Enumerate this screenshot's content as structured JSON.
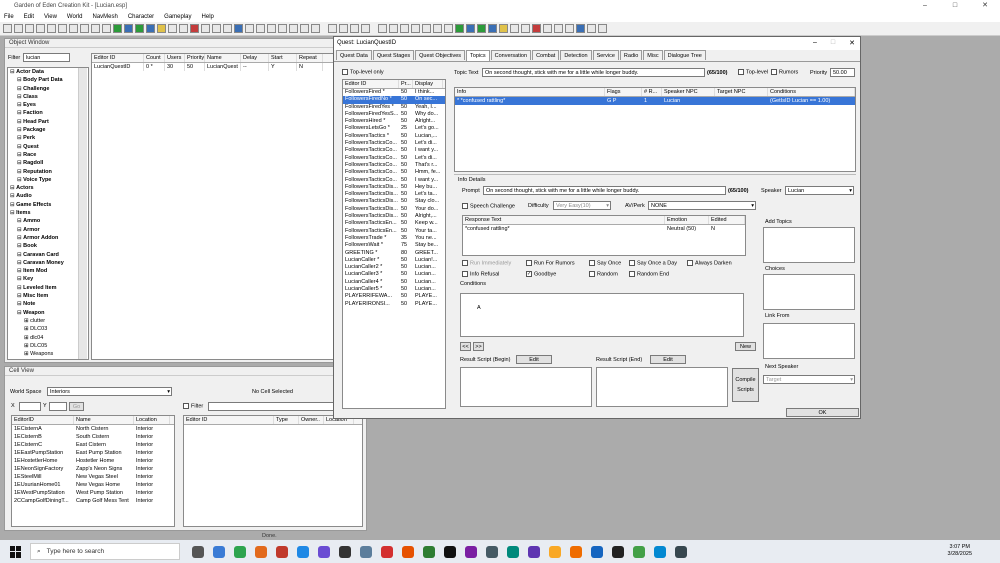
{
  "app": {
    "title": "Garden of Eden Creation Kit - [Lucian.esp]",
    "status": "Done."
  },
  "menu": [
    "File",
    "Edit",
    "View",
    "World",
    "NavMesh",
    "Character",
    "Gameplay",
    "Help"
  ],
  "object_window": {
    "title": "Object Window",
    "filter_label": "Filter",
    "filter_value": "lucian",
    "columns": [
      "Editor ID",
      "Count",
      "Users",
      "Priority",
      "Name",
      "Delay",
      "Start Ga...",
      "Repeat"
    ],
    "row": {
      "editor_id": "LucianQuestID",
      "count": "0 *",
      "users": "30",
      "priority": "50",
      "name": "LucianQuest",
      "delay": "--",
      "start": "Y",
      "repeat": "N"
    },
    "tree": [
      {
        "t": "Actor Data",
        "l": 0,
        "b": 1
      },
      {
        "t": "Body Part Data",
        "l": 1,
        "b": 1
      },
      {
        "t": "Challenge",
        "l": 1,
        "b": 1
      },
      {
        "t": "Class",
        "l": 1,
        "b": 1
      },
      {
        "t": "Eyes",
        "l": 1,
        "b": 1
      },
      {
        "t": "Faction",
        "l": 1,
        "b": 1
      },
      {
        "t": "Head Part",
        "l": 1,
        "b": 1
      },
      {
        "t": "Package",
        "l": 1,
        "b": 1
      },
      {
        "t": "Perk",
        "l": 1,
        "b": 1
      },
      {
        "t": "Quest",
        "l": 1,
        "b": 1
      },
      {
        "t": "Race",
        "l": 1,
        "b": 1
      },
      {
        "t": "Ragdoll",
        "l": 1,
        "b": 1
      },
      {
        "t": "Reputation",
        "l": 1,
        "b": 1
      },
      {
        "t": "Voice Type",
        "l": 1,
        "b": 1
      },
      {
        "t": "Actors",
        "l": 0,
        "b": 1
      },
      {
        "t": "Audio",
        "l": 0,
        "b": 1
      },
      {
        "t": "Game Effects",
        "l": 0,
        "b": 1
      },
      {
        "t": "Items",
        "l": 0,
        "b": 1
      },
      {
        "t": "Ammo",
        "l": 1,
        "b": 1
      },
      {
        "t": "Armor",
        "l": 1,
        "b": 1
      },
      {
        "t": "Armor Addon",
        "l": 1,
        "b": 1
      },
      {
        "t": "Book",
        "l": 1,
        "b": 1
      },
      {
        "t": "Caravan Card",
        "l": 1,
        "b": 1
      },
      {
        "t": "Caravan Money",
        "l": 1,
        "b": 1
      },
      {
        "t": "Item Mod",
        "l": 1,
        "b": 1
      },
      {
        "t": "Key",
        "l": 1,
        "b": 1
      },
      {
        "t": "Leveled Item",
        "l": 1,
        "b": 1
      },
      {
        "t": "Misc Item",
        "l": 1,
        "b": 1
      },
      {
        "t": "Note",
        "l": 1,
        "b": 1
      },
      {
        "t": "Weapon",
        "l": 1,
        "b": 1
      },
      {
        "t": "clutter",
        "l": 2,
        "b": 0
      },
      {
        "t": "DLC03",
        "l": 2,
        "b": 0
      },
      {
        "t": "dlc04",
        "l": 2,
        "b": 0
      },
      {
        "t": "DLC05",
        "l": 2,
        "b": 0
      },
      {
        "t": "Weapons",
        "l": 2,
        "b": 0
      }
    ]
  },
  "cell_view": {
    "title": "Cell View",
    "worldspace_label": "World Space",
    "worldspace_value": "Interiors",
    "no_cell": "No Cell Selected",
    "x_label": "X",
    "y_label": "Y",
    "go": "Go",
    "filter_label": "Filter",
    "columns": [
      "EditorID",
      "Name",
      "Location"
    ],
    "rows": [
      [
        "1ECisternA",
        "North Cistern",
        "Interior"
      ],
      [
        "1ECisternB",
        "South Cistern",
        "Interior"
      ],
      [
        "1ECisternC",
        "East Cistern",
        "Interior"
      ],
      [
        "1EEastPumpStation",
        "East Pump Station",
        "Interior"
      ],
      [
        "1EHostetlerHome",
        "Hostetler Home",
        "Interior"
      ],
      [
        "1ENeonSignFactory",
        "Zapp's Neon Signs",
        "Interior"
      ],
      [
        "1ESteelMill",
        "New Vegas Steel",
        "Interior"
      ],
      [
        "1EUsurianHome01",
        "New Vegas Home",
        "Interior"
      ],
      [
        "1EWestPumpStation",
        "West Pump Station",
        "Interior"
      ],
      [
        "2CCampGolfDiningT...",
        "Camp Golf Mess Tent",
        "Interior"
      ]
    ],
    "ref_columns": [
      "Editor ID",
      "Type",
      "Owner..",
      "Location"
    ]
  },
  "quest": {
    "title": "Quest: LucianQuestID",
    "tabs": [
      "Quest Data",
      "Quest Stages",
      "Quest Objectives",
      "Topics",
      "Conversation",
      "Combat",
      "Detection",
      "Service",
      "Radio",
      "Misc",
      "Dialogue Tree"
    ],
    "toplevel_only": "Top-level only",
    "topic_columns": [
      "Editor ID",
      "Pr...",
      "Display"
    ],
    "topics": [
      [
        "FollowersFired *",
        "50",
        "I think..."
      ],
      [
        "FollowersFiredNo *",
        "50",
        "On sec..."
      ],
      [
        "FollowersFiredYes *",
        "50",
        "Yeah, I..."
      ],
      [
        "FollowersFiredYesS...",
        "50",
        "Why do..."
      ],
      [
        "FollowersHired *",
        "50",
        "Alright..."
      ],
      [
        "FollowersLetsGo *",
        "25",
        "Let's go..."
      ],
      [
        "FollowersTactics *",
        "50",
        "Lucian,..."
      ],
      [
        "FollowersTacticsCo...",
        "50",
        "Let's di..."
      ],
      [
        "FollowersTacticsCo...",
        "50",
        "I want y..."
      ],
      [
        "FollowersTacticsCo...",
        "50",
        "Let's di..."
      ],
      [
        "FollowersTacticsCo...",
        "50",
        "That's r..."
      ],
      [
        "FollowersTacticsCo...",
        "50",
        "Hmm, fe..."
      ],
      [
        "FollowersTacticsCo...",
        "50",
        "I want y..."
      ],
      [
        "FollowersTacticsDis...",
        "50",
        "Hey bu..."
      ],
      [
        "FollowersTacticsDis...",
        "50",
        "Let's ta..."
      ],
      [
        "FollowersTacticsDis...",
        "50",
        "Stay clo..."
      ],
      [
        "FollowersTacticsDis...",
        "50",
        "Your do..."
      ],
      [
        "FollowersTacticsDis...",
        "50",
        "Alright,..."
      ],
      [
        "FollowersTacticsEn...",
        "50",
        "Keep w..."
      ],
      [
        "FollowersTacticsEn...",
        "50",
        "Your ta..."
      ],
      [
        "FollowersTrade *",
        "35",
        "You ne..."
      ],
      [
        "FollowersWait *",
        "75",
        "Stay be..."
      ],
      [
        "GREETING *",
        "80",
        "GREET..."
      ],
      [
        "LucianCaller *",
        "50",
        "Lucian!..."
      ],
      [
        "LucianCaller2 *",
        "50",
        "Lucian..."
      ],
      [
        "LucianCaller3 *",
        "50",
        "Lucian..."
      ],
      [
        "LucianCaller4 *",
        "50",
        "Lucian..."
      ],
      [
        "LucianCaller5 *",
        "50",
        "Lucian..."
      ],
      [
        "PLAYERRIFEWA...",
        "50",
        "PLAYE..."
      ],
      [
        "PLAYERIRONSI...",
        "50",
        "PLAYE..."
      ]
    ],
    "topic_text_label": "Topic Text",
    "topic_text": "On second thought, stick with me for a little while longer buddy.",
    "count": "(65/100)",
    "toplevel_label": "Top-level",
    "rumors_label": "Rumors",
    "priority_label": "Priority",
    "priority": "50.00",
    "info_columns": [
      "Info",
      "Flags",
      "# R...",
      "Speaker NPC",
      "Target NPC",
      "Conditions"
    ],
    "info_row": [
      "* *confused rattling*",
      "G P",
      "1",
      "Lucian",
      "",
      "(GetIsID Lucian == 1.00)"
    ],
    "info_details": "Info Details",
    "prompt_label": "Prompt",
    "prompt": "On second thought, stick with me for a little while longer buddy.",
    "prompt_count": "(65/100)",
    "speaker_label": "Speaker",
    "speaker": "Lucian",
    "speech_label": "Speech Challenge",
    "difficulty_label": "Difficulty",
    "difficulty": "Very Easy(10)",
    "avperk_label": "AV/Perk",
    "avperk": "NONE",
    "response_columns": [
      "Response Text",
      "Emotion",
      "Edited"
    ],
    "response": [
      "*confused rattling*",
      "Neutral (50)",
      "N"
    ],
    "add_topics": "Add Topics",
    "choices": "Choices",
    "link_from": "Link From",
    "next_speaker": "Next Speaker",
    "target": "Target",
    "flags": [
      "Run Immediately",
      "Run For Rumors",
      "Say Once",
      "Say Once a Day",
      "Always Darken",
      "Info Refusal",
      "Goodbye",
      "Random",
      "Random End"
    ],
    "conditions_label": "Conditions",
    "cond_first": "A",
    "new_btn": "New",
    "nav_prev": "<<",
    "nav_next": ">>",
    "result_begin": "Result Script (Begin)",
    "result_end": "Result Script (End)",
    "edit": "Edit",
    "compile": "Compile Scripts",
    "ok": "OK"
  },
  "taskbar": {
    "search": "Type here to search",
    "time": "3:07 PM",
    "date": "3/28/2025"
  }
}
